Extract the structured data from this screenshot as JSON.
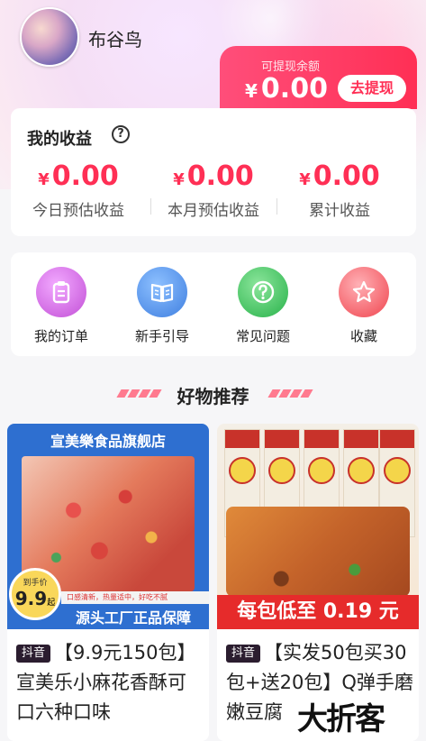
{
  "user": {
    "name": "布谷鸟"
  },
  "balance": {
    "label": "可提现余额",
    "currency": "¥",
    "amount": "0.00",
    "withdraw_label": "去提现"
  },
  "earnings": {
    "title": "我的收益",
    "items": [
      {
        "currency": "¥",
        "value": "0.00",
        "label": "今日预估收益"
      },
      {
        "currency": "¥",
        "value": "0.00",
        "label": "本月预估收益"
      },
      {
        "currency": "¥",
        "value": "0.00",
        "label": "累计收益"
      }
    ]
  },
  "menu": {
    "items": [
      {
        "label": "我的订单",
        "icon": "clipboard-icon",
        "color": "#c24fd6"
      },
      {
        "label": "新手引导",
        "icon": "book-icon",
        "color": "#3f7fe0"
      },
      {
        "label": "常见问题",
        "icon": "question-icon",
        "color": "#28b24a"
      },
      {
        "label": "收藏",
        "icon": "star-icon",
        "color": "#f0454f"
      }
    ]
  },
  "recommend": {
    "title": "好物推荐"
  },
  "products": [
    {
      "store": "宣美樂食品旗舰店",
      "badge_small": "到手价",
      "badge_price": "9.9",
      "badge_unit": "起",
      "band_text": "口感清新，热量适中，好吃不腻",
      "slogan": "源头工厂正品保障",
      "tag": "抖音",
      "title": "【9.9元150包】宣美乐小麻花香酥可口六种口味"
    },
    {
      "banner": "每包低至 0.19 元",
      "tag": "抖音",
      "title": "【实发50包买30包+送20包】Q弹手磨嫩豆腐"
    }
  ],
  "watermark": "大折客"
}
